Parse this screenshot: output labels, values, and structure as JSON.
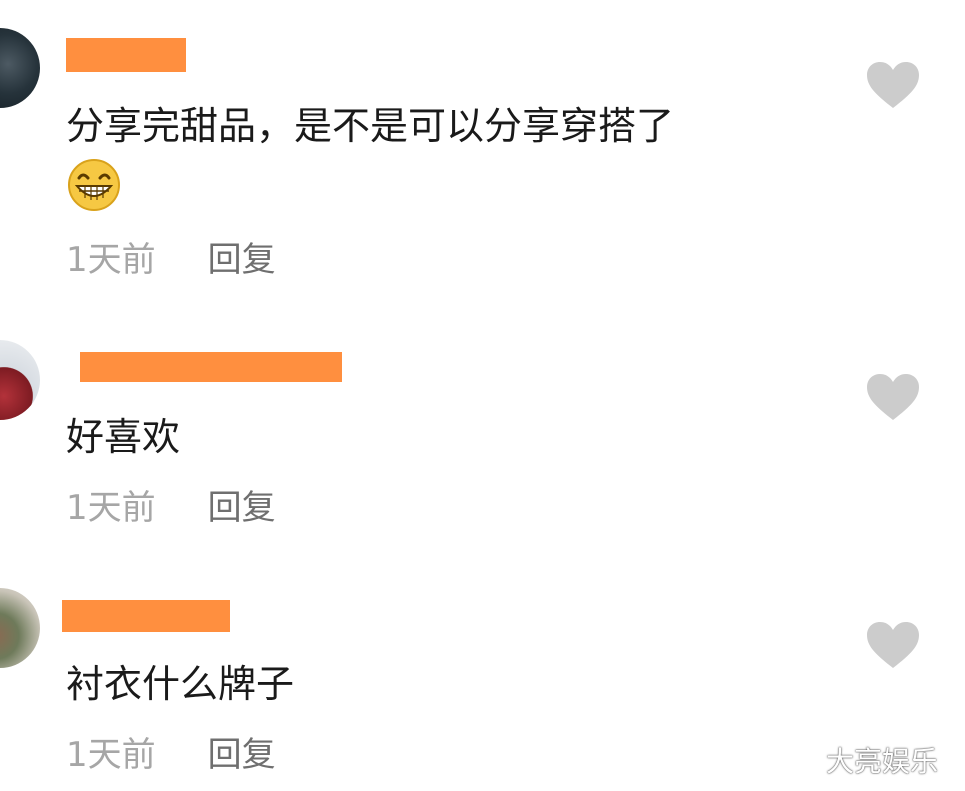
{
  "comments": [
    {
      "avatar_icon": "user-avatar-icon",
      "text": "分享完甜品，是不是可以分享穿搭了",
      "emoji_icon": "grinning-face-icon",
      "time": "1天前",
      "reply_label": "回复"
    },
    {
      "avatar_icon": "user-avatar-icon",
      "text": "好喜欢",
      "time": "1天前",
      "reply_label": "回复"
    },
    {
      "avatar_icon": "user-avatar-icon",
      "text": "衬衣什么牌子",
      "time": "1天前",
      "reply_label": "回复"
    }
  ],
  "like_icon": "heart-icon",
  "watermark": "大亮娱乐",
  "colors": {
    "redaction": "#ff8f3f",
    "comment_text": "#1a1a1a",
    "time_text": "#a6a6a6",
    "reply_text": "#6f6f6f",
    "like_icon": "#cccccc"
  }
}
